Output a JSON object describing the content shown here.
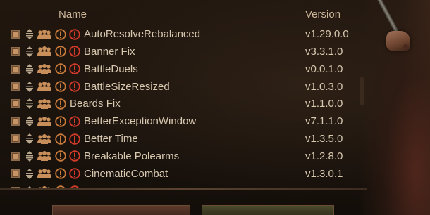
{
  "header": {
    "name_label": "Name",
    "version_label": "Version"
  },
  "colors": {
    "text": "#d8c8b0",
    "warning_red": "#d23a2a",
    "warning_orange": "#c87a3a",
    "checkbox": "#c79465"
  },
  "mods": [
    {
      "name": "AutoResolveRebalanced",
      "version": "v1.29.0.0",
      "people_icon": true,
      "warnings": [
        "orange",
        "red"
      ]
    },
    {
      "name": "Banner Fix",
      "version": "v3.3.1.0",
      "people_icon": true,
      "warnings": [
        "orange",
        "red"
      ]
    },
    {
      "name": "BattleDuels",
      "version": "v0.0.1.0",
      "people_icon": true,
      "warnings": [
        "orange",
        "red"
      ]
    },
    {
      "name": "BattleSizeResized",
      "version": "v1.0.3.0",
      "people_icon": true,
      "warnings": [
        "orange",
        "red"
      ]
    },
    {
      "name": "Beards Fix",
      "version": "v1.1.0.0",
      "people_icon": true,
      "warnings": [
        "orange"
      ]
    },
    {
      "name": "BetterExceptionWindow",
      "version": "v7.1.1.0",
      "people_icon": true,
      "warnings": [
        "orange",
        "red"
      ]
    },
    {
      "name": "Better Time",
      "version": "v1.3.5.0",
      "people_icon": true,
      "warnings": [
        "orange",
        "red"
      ]
    },
    {
      "name": "Breakable Polearms",
      "version": "v1.2.8.0",
      "people_icon": true,
      "warnings": [
        "orange",
        "red"
      ]
    },
    {
      "name": "CinematicCombat",
      "version": "v1.3.0.1",
      "people_icon": true,
      "warnings": [
        "orange",
        "red"
      ]
    },
    {
      "name": "",
      "version": "",
      "people_icon": true,
      "warnings": [
        "orange",
        "red"
      ]
    }
  ],
  "icons": {
    "checkbox": "checkbox-icon",
    "drag": "drag-handle-icon",
    "people": "multiplayer-people-icon",
    "warning": "exclamation-circle-icon"
  }
}
